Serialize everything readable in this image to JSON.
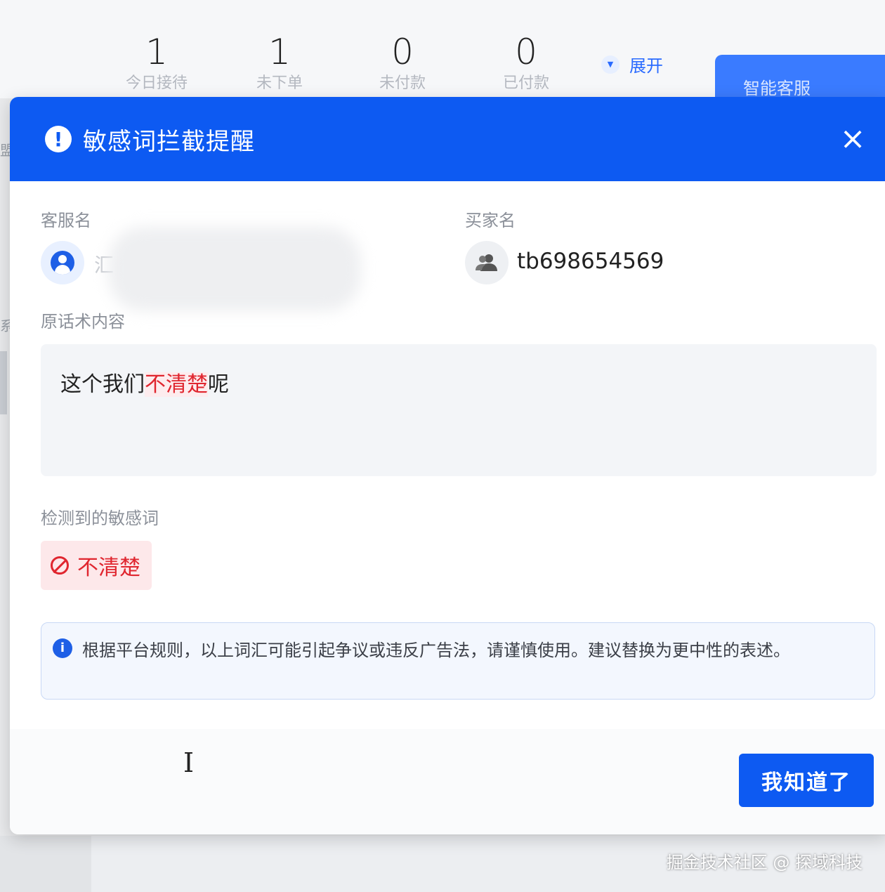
{
  "stats": [
    {
      "value": "1",
      "label": "今日接待"
    },
    {
      "value": "1",
      "label": "未下单"
    },
    {
      "value": "0",
      "label": "未付款"
    },
    {
      "value": "0",
      "label": "已付款"
    }
  ],
  "expand_label": "展开",
  "smart_service_tab": "智能客服",
  "edge_chars": [
    "盟",
    "系"
  ],
  "modal": {
    "title": "敏感词拦截提醒",
    "close_icon": "×",
    "agent_label": "客服名",
    "agent_name_visible": "汇",
    "buyer_label": "买家名",
    "buyer_name": "tb698654569",
    "original_label": "原话术内容",
    "original_text": {
      "before": "这个我们",
      "highlight": "不清楚",
      "after": "呢"
    },
    "detected_label": "检测到的敏感词",
    "detected_words": [
      "不清楚"
    ],
    "notice_text": "根据平台规则，以上词汇可能引起争议或违反广告法，请谨慎使用。建议替换为更中性的表述。",
    "confirm_button": "我知道了"
  },
  "watermark": "掘金技术社区 @ 探域科技",
  "colors": {
    "primary": "#0d5af2",
    "danger": "#e0262f",
    "danger_bg": "#fde8ea"
  }
}
